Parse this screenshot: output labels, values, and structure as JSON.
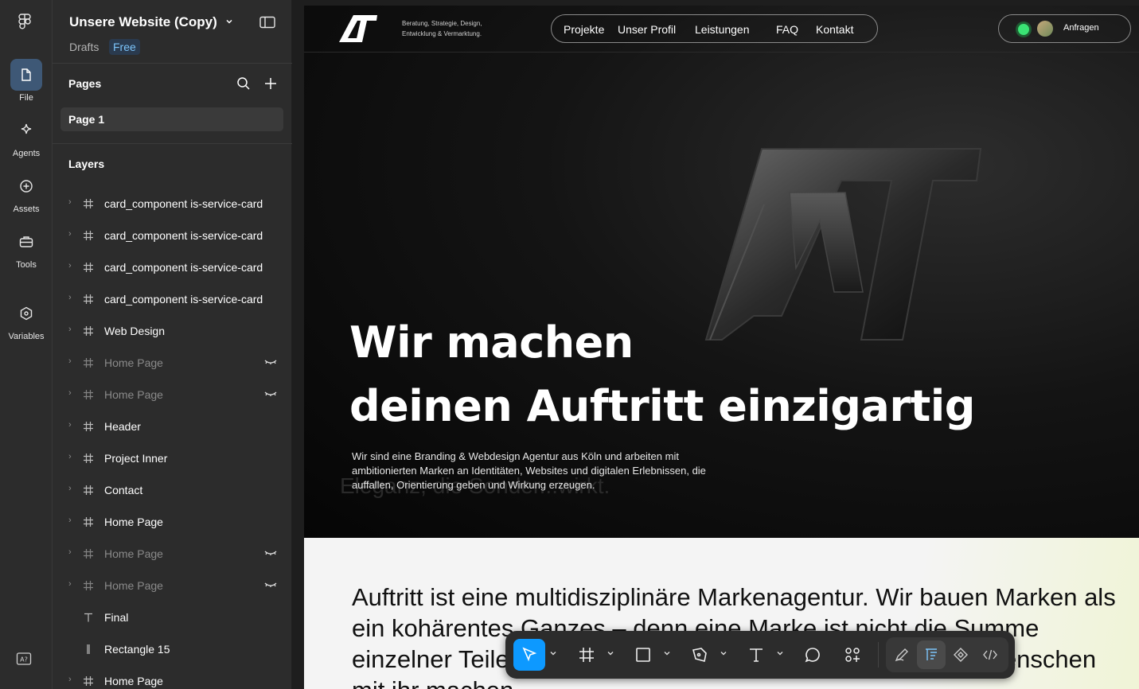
{
  "rail": {
    "items": [
      {
        "label": "File",
        "icon": "file-icon"
      },
      {
        "label": "Agents",
        "icon": "sparkle-icon"
      },
      {
        "label": "Assets",
        "icon": "assets-icon"
      },
      {
        "label": "Tools",
        "icon": "toolbox-icon"
      },
      {
        "label": "Variables",
        "icon": "variables-icon"
      }
    ]
  },
  "panel": {
    "file_title": "Unsere Website (Copy)",
    "drafts": "Drafts",
    "plan_badge": "Free",
    "pages_title": "Pages",
    "current_page": "Page 1",
    "layers_title": "Layers",
    "layers": [
      {
        "name": "card_component is-service-card",
        "type": "frame",
        "hidden": false
      },
      {
        "name": "card_component is-service-card",
        "type": "frame",
        "hidden": false
      },
      {
        "name": "card_component is-service-card",
        "type": "frame",
        "hidden": false
      },
      {
        "name": "card_component is-service-card",
        "type": "frame",
        "hidden": false
      },
      {
        "name": "Web Design",
        "type": "frame",
        "hidden": false
      },
      {
        "name": "Home Page",
        "type": "frame",
        "hidden": true
      },
      {
        "name": "Home Page",
        "type": "frame",
        "hidden": true
      },
      {
        "name": "Header",
        "type": "frame",
        "hidden": false
      },
      {
        "name": "Project Inner",
        "type": "frame",
        "hidden": false
      },
      {
        "name": "Contact",
        "type": "frame",
        "hidden": false
      },
      {
        "name": "Home Page",
        "type": "frame",
        "hidden": false
      },
      {
        "name": "Home Page",
        "type": "frame",
        "hidden": true
      },
      {
        "name": "Home Page",
        "type": "frame",
        "hidden": true
      },
      {
        "name": "Final",
        "type": "text",
        "hidden": false
      },
      {
        "name": "Rectangle 15",
        "type": "rect",
        "hidden": false
      },
      {
        "name": "Home Page",
        "type": "frame",
        "hidden": false
      }
    ]
  },
  "site": {
    "tagline_line1": "Beratung, Strategie, Design,",
    "tagline_line2": "Entwicklung & Vermarktung.",
    "nav": [
      "Projekte",
      "Unser Profil",
      "Leistungen",
      "FAQ",
      "Kontakt"
    ],
    "cta": "Anfragen",
    "headline_line1": "Wir machen",
    "headline_line2": "deinen Auftritt einzigartig",
    "ghost_text": "Eleganz, die Sonder...wirkt.",
    "intro": "Wir sind eine Branding & Webdesign Agentur aus Köln und arbeiten mit ambitionierten Marken an Identitäten, Websites und digitalen Erlebnissen, die auffallen, Orientierung geben und Wirkung erzeugen.",
    "statement": "Auftritt ist eine multidisziplinäre Markenagentur. Wir bauen Marken als ein kohärentes Ganzes – denn eine Marke ist nicht die Summe einzelner Teile, sondern die Summe der Erfahrungen, die Menschen mit ihr machen."
  },
  "toolbar": {
    "tools": [
      "move-tool",
      "frame-tool",
      "shape-tool",
      "pen-tool",
      "text-tool",
      "comment-tool",
      "actions-tool"
    ],
    "modes": [
      "draw-mode",
      "design-mode",
      "dev-component-mode",
      "dev-mode"
    ],
    "accent": "#0d99ff"
  }
}
